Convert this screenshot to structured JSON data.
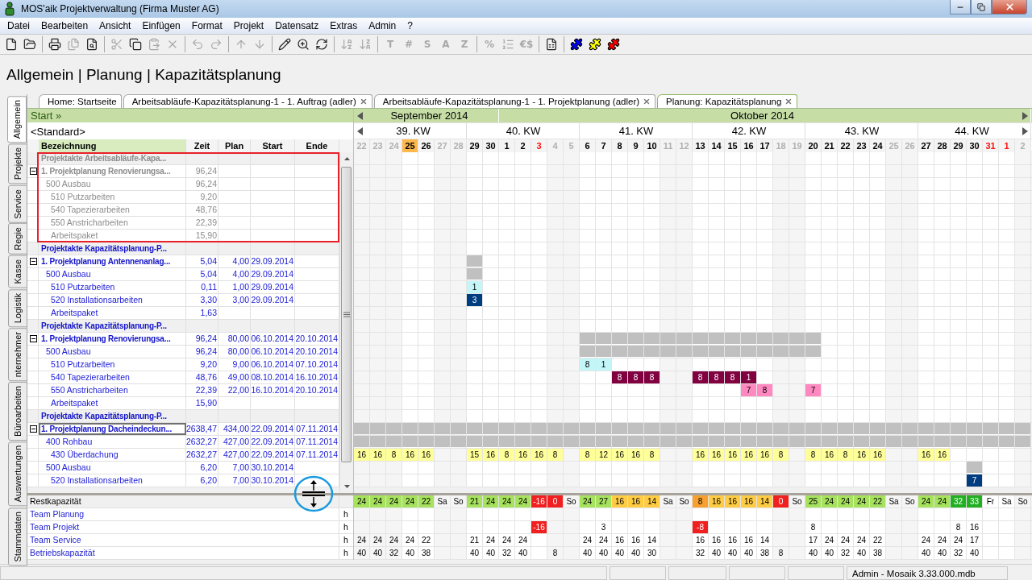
{
  "window": {
    "title": "MOS'aik Projektverwaltung (Firma Muster AG)"
  },
  "menu": [
    "Datei",
    "Bearbeiten",
    "Ansicht",
    "Einfügen",
    "Format",
    "Projekt",
    "Datensatz",
    "Extras",
    "Admin",
    "?"
  ],
  "toolbar": [
    {
      "kind": "new",
      "disabled": false
    },
    {
      "kind": "open",
      "disabled": false
    },
    {
      "kind": "separator"
    },
    {
      "kind": "print",
      "disabled": false
    },
    {
      "kind": "printall",
      "disabled": true
    },
    {
      "kind": "preview",
      "disabled": false
    },
    {
      "kind": "separator"
    },
    {
      "kind": "cut",
      "disabled": true
    },
    {
      "kind": "copy",
      "disabled": false
    },
    {
      "kind": "paste",
      "disabled": true
    },
    {
      "kind": "delete",
      "disabled": true
    },
    {
      "kind": "separator"
    },
    {
      "kind": "undo",
      "disabled": true
    },
    {
      "kind": "redo",
      "disabled": true
    },
    {
      "kind": "separator"
    },
    {
      "kind": "up",
      "disabled": true
    },
    {
      "kind": "down",
      "disabled": true
    },
    {
      "kind": "separator"
    },
    {
      "kind": "edit",
      "disabled": false
    },
    {
      "kind": "zoom",
      "disabled": false
    },
    {
      "kind": "refresh",
      "disabled": false
    },
    {
      "kind": "separator"
    },
    {
      "kind": "sortaz",
      "disabled": true
    },
    {
      "kind": "sortza",
      "disabled": true
    },
    {
      "kind": "separator"
    },
    {
      "kind": "glyph",
      "text": "T",
      "disabled": true
    },
    {
      "kind": "glyph",
      "text": "#",
      "disabled": true
    },
    {
      "kind": "glyph",
      "text": "S",
      "disabled": true
    },
    {
      "kind": "glyph",
      "text": "A",
      "disabled": true
    },
    {
      "kind": "glyph",
      "text": "Z",
      "disabled": true
    },
    {
      "kind": "separator"
    },
    {
      "kind": "glyph",
      "text": "%",
      "disabled": true
    },
    {
      "kind": "numbering",
      "disabled": true
    },
    {
      "kind": "glyph",
      "text": "€$",
      "disabled": true
    },
    {
      "kind": "separator"
    },
    {
      "kind": "export",
      "disabled": false
    },
    {
      "kind": "separator"
    },
    {
      "kind": "puzzle",
      "color": "#0000ff"
    },
    {
      "kind": "puzzle",
      "color": "#ffff00"
    },
    {
      "kind": "puzzle",
      "color": "#ff0000"
    }
  ],
  "breadcrumb": "Allgemein | Planung | Kapazitätsplanung",
  "vertical_tabs": [
    {
      "label": "Allgemein",
      "selected": true
    },
    {
      "label": "Projekte",
      "selected": false
    },
    {
      "label": "Service",
      "selected": false
    },
    {
      "label": "Regie",
      "selected": false
    },
    {
      "label": "Kasse",
      "selected": false
    },
    {
      "label": "Logistik",
      "selected": false
    },
    {
      "label": "nternehmer",
      "selected": false
    },
    {
      "label": "Büroarbeiten",
      "selected": false
    },
    {
      "label": "Auswertungen",
      "selected": false
    },
    {
      "label": "Stammdaten",
      "selected": false
    }
  ],
  "doc_tabs": [
    {
      "label": "Home: Startseite",
      "closable": false,
      "selected": false
    },
    {
      "label": "Arbeitsabläufe-Kapazitätsplanung-1 - 1. Auftrag (adler)",
      "closable": true,
      "selected": false
    },
    {
      "label": "Arbeitsabläufe-Kapazitätsplanung-1 - 1. Projektplanung (adler)",
      "closable": true,
      "selected": false
    },
    {
      "label": "Planung: Kapazitätsplanung",
      "closable": true,
      "selected": true
    }
  ],
  "start_link": "Start »",
  "view": "<Standard>",
  "columns": [
    "Bezeichnung",
    "Zeit",
    "Plan",
    "Start",
    "Ende"
  ],
  "months": [
    {
      "label": "September 2014",
      "days": [
        {
          "label": "22",
          "kind": "past"
        },
        {
          "label": "23",
          "kind": "past"
        },
        {
          "label": "24",
          "kind": "past"
        },
        {
          "label": "25",
          "kind": "today"
        },
        {
          "label": "26",
          "kind": "work"
        },
        {
          "label": "27",
          "kind": "weekend"
        },
        {
          "label": "28",
          "kind": "weekend"
        },
        {
          "label": "29",
          "kind": "work"
        },
        {
          "label": "30",
          "kind": "work"
        }
      ]
    },
    {
      "label": "Oktober 2014",
      "days": [
        {
          "label": "1",
          "kind": "work"
        },
        {
          "label": "2",
          "kind": "work"
        },
        {
          "label": "3",
          "kind": "holiday"
        },
        {
          "label": "4",
          "kind": "weekend"
        },
        {
          "label": "5",
          "kind": "weekend"
        },
        {
          "label": "6",
          "kind": "work"
        },
        {
          "label": "7",
          "kind": "work"
        },
        {
          "label": "8",
          "kind": "work"
        },
        {
          "label": "9",
          "kind": "work"
        },
        {
          "label": "10",
          "kind": "work"
        },
        {
          "label": "11",
          "kind": "weekend"
        },
        {
          "label": "12",
          "kind": "weekend"
        },
        {
          "label": "13",
          "kind": "work"
        },
        {
          "label": "14",
          "kind": "work"
        },
        {
          "label": "15",
          "kind": "work"
        },
        {
          "label": "16",
          "kind": "work"
        },
        {
          "label": "17",
          "kind": "work"
        },
        {
          "label": "18",
          "kind": "weekend"
        },
        {
          "label": "19",
          "kind": "weekend"
        },
        {
          "label": "20",
          "kind": "work"
        },
        {
          "label": "21",
          "kind": "work"
        },
        {
          "label": "22",
          "kind": "work"
        },
        {
          "label": "23",
          "kind": "work"
        },
        {
          "label": "24",
          "kind": "work"
        },
        {
          "label": "25",
          "kind": "weekend"
        },
        {
          "label": "26",
          "kind": "weekend"
        },
        {
          "label": "27",
          "kind": "work"
        },
        {
          "label": "28",
          "kind": "work"
        },
        {
          "label": "29",
          "kind": "work"
        },
        {
          "label": "30",
          "kind": "work"
        },
        {
          "label": "31",
          "kind": "holiday"
        },
        {
          "label": "1",
          "kind": "holiday"
        },
        {
          "label": "2",
          "kind": "weekend"
        }
      ]
    }
  ],
  "weeks": [
    "39. KW",
    "40. KW",
    "41. KW",
    "42. KW",
    "43. KW",
    "44. KW"
  ],
  "projects": [
    {
      "title": "Projektakte Arbeitsabläufe-Kapa...",
      "muted": true,
      "highlighted": true,
      "plans": [
        {
          "label": "1. Projektplanung Renovierungsa...",
          "zeit": "96,24",
          "expanded": true,
          "focused": false,
          "children": [
            {
              "label": "500 Ausbau",
              "zeit": "96,24",
              "children": [
                {
                  "label": "510 Putzarbeiten",
                  "zeit": "9,20"
                },
                {
                  "label": "540 Tapezierarbeiten",
                  "zeit": "48,76"
                },
                {
                  "label": "550 Anstricharbeiten",
                  "zeit": "22,39"
                },
                {
                  "label": "Arbeitspaket",
                  "zeit": "15,90"
                }
              ]
            }
          ]
        }
      ]
    },
    {
      "title": "Projektakte Kapazitätsplanung-P...",
      "muted": false,
      "highlighted": false,
      "plans": [
        {
          "label": "1. Projektplanung Antennenanlag...",
          "zeit": "5,04",
          "plan": "4,00",
          "start": "29.09.2014",
          "expanded": true,
          "focused": false,
          "cells": [
            null,
            null,
            null,
            null,
            null,
            null,
            null,
            {
              "color": "#c0c0c0"
            }
          ],
          "children": [
            {
              "label": "500 Ausbau",
              "zeit": "5,04",
              "plan": "4,00",
              "start": "29.09.2014",
              "cells": [
                null,
                null,
                null,
                null,
                null,
                null,
                null,
                {
                  "color": "#c0c0c0"
                }
              ],
              "children": [
                {
                  "label": "510 Putzarbeiten",
                  "zeit": "0,11",
                  "plan": "1,00",
                  "start": "29.09.2014",
                  "cells": [
                    null,
                    null,
                    null,
                    null,
                    null,
                    null,
                    null,
                    {
                      "color": "#c4f6f8",
                      "text": "1"
                    }
                  ]
                },
                {
                  "label": "520 Installationsarbeiten",
                  "zeit": "3,30",
                  "plan": "3,00",
                  "start": "29.09.2014",
                  "cells": [
                    null,
                    null,
                    null,
                    null,
                    null,
                    null,
                    null,
                    {
                      "color": "#003c80",
                      "text": "3"
                    }
                  ]
                },
                {
                  "label": "Arbeitspaket",
                  "zeit": "1,63"
                }
              ]
            }
          ]
        }
      ]
    },
    {
      "title": "Projektakte Kapazitätsplanung-P...",
      "muted": false,
      "highlighted": false,
      "plans": [
        {
          "label": "1. Projektplanung Renovierungsa...",
          "zeit": "96,24",
          "plan": "80,00",
          "start": "06.10.2014",
          "ende": "20.10.2014",
          "expanded": true,
          "focused": false,
          "cells": [
            null,
            null,
            null,
            null,
            null,
            null,
            null,
            null,
            null,
            null,
            null,
            null,
            null,
            null,
            {
              "color": "#c0c0c0"
            },
            {
              "color": "#c0c0c0"
            },
            {
              "color": "#c0c0c0"
            },
            {
              "color": "#c0c0c0"
            },
            {
              "color": "#c0c0c0"
            },
            {
              "color": "#c0c0c0"
            },
            {
              "color": "#c0c0c0"
            },
            {
              "color": "#c0c0c0"
            },
            {
              "color": "#c0c0c0"
            },
            {
              "color": "#c0c0c0"
            },
            {
              "color": "#c0c0c0"
            },
            {
              "color": "#c0c0c0"
            },
            {
              "color": "#c0c0c0"
            },
            {
              "color": "#c0c0c0"
            },
            {
              "color": "#c0c0c0"
            }
          ],
          "children": [
            {
              "label": "500 Ausbau",
              "zeit": "96,24",
              "plan": "80,00",
              "start": "06.10.2014",
              "ende": "20.10.2014",
              "cells": [
                null,
                null,
                null,
                null,
                null,
                null,
                null,
                null,
                null,
                null,
                null,
                null,
                null,
                null,
                {
                  "color": "#c0c0c0"
                },
                {
                  "color": "#c0c0c0"
                },
                {
                  "color": "#c0c0c0"
                },
                {
                  "color": "#c0c0c0"
                },
                {
                  "color": "#c0c0c0"
                },
                {
                  "color": "#c0c0c0"
                },
                {
                  "color": "#c0c0c0"
                },
                {
                  "color": "#c0c0c0"
                },
                {
                  "color": "#c0c0c0"
                },
                {
                  "color": "#c0c0c0"
                },
                {
                  "color": "#c0c0c0"
                },
                {
                  "color": "#c0c0c0"
                },
                {
                  "color": "#c0c0c0"
                },
                {
                  "color": "#c0c0c0"
                },
                {
                  "color": "#c0c0c0"
                }
              ],
              "children": [
                {
                  "label": "510 Putzarbeiten",
                  "zeit": "9,20",
                  "plan": "9,00",
                  "start": "06.10.2014",
                  "ende": "07.10.2014",
                  "cells": [
                    null,
                    null,
                    null,
                    null,
                    null,
                    null,
                    null,
                    null,
                    null,
                    null,
                    null,
                    null,
                    null,
                    null,
                    {
                      "color": "#c4f6f8",
                      "text": "8"
                    },
                    {
                      "color": "#c4f6f8",
                      "text": "1"
                    }
                  ]
                },
                {
                  "label": "540 Tapezierarbeiten",
                  "zeit": "48,76",
                  "plan": "49,00",
                  "start": "08.10.2014",
                  "ende": "16.10.2014",
                  "cells": [
                    null,
                    null,
                    null,
                    null,
                    null,
                    null,
                    null,
                    null,
                    null,
                    null,
                    null,
                    null,
                    null,
                    null,
                    null,
                    null,
                    {
                      "color": "#800040",
                      "text": "8"
                    },
                    {
                      "color": "#800040",
                      "text": "8"
                    },
                    {
                      "color": "#800040",
                      "text": "8"
                    },
                    null,
                    null,
                    {
                      "color": "#800040",
                      "text": "8"
                    },
                    {
                      "color": "#800040",
                      "text": "8"
                    },
                    {
                      "color": "#800040",
                      "text": "8"
                    },
                    {
                      "color": "#800040",
                      "text": "1"
                    }
                  ]
                },
                {
                  "label": "550 Anstricharbeiten",
                  "zeit": "22,39",
                  "plan": "22,00",
                  "start": "16.10.2014",
                  "ende": "20.10.2014",
                  "cells": [
                    null,
                    null,
                    null,
                    null,
                    null,
                    null,
                    null,
                    null,
                    null,
                    null,
                    null,
                    null,
                    null,
                    null,
                    null,
                    null,
                    null,
                    null,
                    null,
                    null,
                    null,
                    null,
                    null,
                    null,
                    {
                      "color": "#ff88c0",
                      "text": "7"
                    },
                    {
                      "color": "#ff88c0",
                      "text": "8"
                    },
                    null,
                    null,
                    {
                      "color": "#ff88c0",
                      "text": "7"
                    }
                  ]
                },
                {
                  "label": "Arbeitspaket",
                  "zeit": "15,90"
                }
              ]
            }
          ]
        }
      ]
    },
    {
      "title": "Projektakte Kapazitätsplanung-P...",
      "muted": false,
      "highlighted": false,
      "plans": [
        {
          "label": "1. Projektplanung Dacheindeckun...",
          "zeit": "2638,47",
          "plan": "434,00",
          "start": "22.09.2014",
          "ende": "07.11.2014",
          "expanded": true,
          "focused": true,
          "cells": [
            {
              "color": "#c0c0c0"
            },
            {
              "color": "#c0c0c0"
            },
            {
              "color": "#c0c0c0"
            },
            {
              "color": "#c0c0c0"
            },
            {
              "color": "#c0c0c0"
            },
            {
              "color": "#c0c0c0"
            },
            {
              "color": "#c0c0c0"
            },
            {
              "color": "#c0c0c0"
            },
            {
              "color": "#c0c0c0"
            },
            {
              "color": "#c0c0c0"
            },
            {
              "color": "#c0c0c0"
            },
            {
              "color": "#c0c0c0"
            },
            {
              "color": "#c0c0c0"
            },
            {
              "color": "#c0c0c0"
            },
            {
              "color": "#c0c0c0"
            },
            {
              "color": "#c0c0c0"
            },
            {
              "color": "#c0c0c0"
            },
            {
              "color": "#c0c0c0"
            },
            {
              "color": "#c0c0c0"
            },
            {
              "color": "#c0c0c0"
            },
            {
              "color": "#c0c0c0"
            },
            {
              "color": "#c0c0c0"
            },
            {
              "color": "#c0c0c0"
            },
            {
              "color": "#c0c0c0"
            },
            {
              "color": "#c0c0c0"
            },
            {
              "color": "#c0c0c0"
            },
            {
              "color": "#c0c0c0"
            },
            {
              "color": "#c0c0c0"
            },
            {
              "color": "#c0c0c0"
            },
            {
              "color": "#c0c0c0"
            },
            {
              "color": "#c0c0c0"
            },
            {
              "color": "#c0c0c0"
            },
            {
              "color": "#c0c0c0"
            },
            {
              "color": "#c0c0c0"
            },
            {
              "color": "#c0c0c0"
            },
            {
              "color": "#c0c0c0"
            },
            {
              "color": "#c0c0c0"
            },
            {
              "color": "#c0c0c0"
            },
            {
              "color": "#c0c0c0"
            },
            {
              "color": "#c0c0c0"
            },
            {
              "color": "#c0c0c0"
            },
            {
              "color": "#c0c0c0"
            }
          ],
          "children": [
            {
              "label": "400 Rohbau",
              "zeit": "2632,27",
              "plan": "427,00",
              "start": "22.09.2014",
              "ende": "07.11.2014",
              "cells": [
                {
                  "color": "#c0c0c0"
                },
                {
                  "color": "#c0c0c0"
                },
                {
                  "color": "#c0c0c0"
                },
                {
                  "color": "#c0c0c0"
                },
                {
                  "color": "#c0c0c0"
                },
                {
                  "color": "#c0c0c0"
                },
                {
                  "color": "#c0c0c0"
                },
                {
                  "color": "#c0c0c0"
                },
                {
                  "color": "#c0c0c0"
                },
                {
                  "color": "#c0c0c0"
                },
                {
                  "color": "#c0c0c0"
                },
                {
                  "color": "#c0c0c0"
                },
                {
                  "color": "#c0c0c0"
                },
                {
                  "color": "#c0c0c0"
                },
                {
                  "color": "#c0c0c0"
                },
                {
                  "color": "#c0c0c0"
                },
                {
                  "color": "#c0c0c0"
                },
                {
                  "color": "#c0c0c0"
                },
                {
                  "color": "#c0c0c0"
                },
                {
                  "color": "#c0c0c0"
                },
                {
                  "color": "#c0c0c0"
                },
                {
                  "color": "#c0c0c0"
                },
                {
                  "color": "#c0c0c0"
                },
                {
                  "color": "#c0c0c0"
                },
                {
                  "color": "#c0c0c0"
                },
                {
                  "color": "#c0c0c0"
                },
                {
                  "color": "#c0c0c0"
                },
                {
                  "color": "#c0c0c0"
                },
                {
                  "color": "#c0c0c0"
                },
                {
                  "color": "#c0c0c0"
                },
                {
                  "color": "#c0c0c0"
                },
                {
                  "color": "#c0c0c0"
                },
                {
                  "color": "#c0c0c0"
                },
                {
                  "color": "#c0c0c0"
                },
                {
                  "color": "#c0c0c0"
                },
                {
                  "color": "#c0c0c0"
                },
                {
                  "color": "#c0c0c0"
                },
                {
                  "color": "#c0c0c0"
                },
                {
                  "color": "#c0c0c0"
                },
                {
                  "color": "#c0c0c0"
                },
                {
                  "color": "#c0c0c0"
                },
                {
                  "color": "#c0c0c0"
                }
              ],
              "children": [
                {
                  "label": "430 Überdachung",
                  "zeit": "2632,27",
                  "plan": "427,00",
                  "start": "22.09.2014",
                  "ende": "07.11.2014",
                  "cells": [
                    {
                      "color": "#ffff99",
                      "text": "16"
                    },
                    {
                      "color": "#ffff99",
                      "text": "16"
                    },
                    {
                      "color": "#ffff99",
                      "text": "8"
                    },
                    {
                      "color": "#ffff99",
                      "text": "16"
                    },
                    {
                      "color": "#ffff99",
                      "text": "16"
                    },
                    null,
                    null,
                    {
                      "color": "#ffff99",
                      "text": "15"
                    },
                    {
                      "color": "#ffff99",
                      "text": "16"
                    },
                    {
                      "color": "#ffff99",
                      "text": "8"
                    },
                    {
                      "color": "#ffff99",
                      "text": "16"
                    },
                    {
                      "color": "#ffff99",
                      "text": "16"
                    },
                    {
                      "color": "#ffff99",
                      "text": "8"
                    },
                    null,
                    {
                      "color": "#ffff99",
                      "text": "8"
                    },
                    {
                      "color": "#ffff99",
                      "text": "12"
                    },
                    {
                      "color": "#ffff99",
                      "text": "16"
                    },
                    {
                      "color": "#ffff99",
                      "text": "16"
                    },
                    {
                      "color": "#ffff99",
                      "text": "8"
                    },
                    null,
                    null,
                    {
                      "color": "#ffff99",
                      "text": "16"
                    },
                    {
                      "color": "#ffff99",
                      "text": "16"
                    },
                    {
                      "color": "#ffff99",
                      "text": "16"
                    },
                    {
                      "color": "#ffff99",
                      "text": "16"
                    },
                    {
                      "color": "#ffff99",
                      "text": "16"
                    },
                    {
                      "color": "#ffff99",
                      "text": "8"
                    },
                    null,
                    {
                      "color": "#ffff99",
                      "text": "8"
                    },
                    {
                      "color": "#ffff99",
                      "text": "16"
                    },
                    {
                      "color": "#ffff99",
                      "text": "8"
                    },
                    {
                      "color": "#ffff99",
                      "text": "16"
                    },
                    {
                      "color": "#ffff99",
                      "text": "16"
                    },
                    null,
                    null,
                    {
                      "color": "#ffff99",
                      "text": "16"
                    },
                    {
                      "color": "#ffff99",
                      "text": "16"
                    }
                  ]
                }
              ]
            },
            {
              "label": "500 Ausbau",
              "zeit": "6,20",
              "plan": "7,00",
              "start": "30.10.2014",
              "cells": [
                null,
                null,
                null,
                null,
                null,
                null,
                null,
                null,
                null,
                null,
                null,
                null,
                null,
                null,
                null,
                null,
                null,
                null,
                null,
                null,
                null,
                null,
                null,
                null,
                null,
                null,
                null,
                null,
                null,
                null,
                null,
                null,
                null,
                null,
                null,
                null,
                null,
                null,
                {
                  "color": "#c0c0c0"
                }
              ],
              "children": [
                {
                  "label": "520 Installationsarbeiten",
                  "zeit": "6,20",
                  "plan": "7,00",
                  "start": "30.10.2014",
                  "cells": [
                    null,
                    null,
                    null,
                    null,
                    null,
                    null,
                    null,
                    null,
                    null,
                    null,
                    null,
                    null,
                    null,
                    null,
                    null,
                    null,
                    null,
                    null,
                    null,
                    null,
                    null,
                    null,
                    null,
                    null,
                    null,
                    null,
                    null,
                    null,
                    null,
                    null,
                    null,
                    null,
                    null,
                    null,
                    null,
                    null,
                    null,
                    null,
                    {
                      "color": "#003c80",
                      "text": "7"
                    }
                  ]
                }
              ]
            }
          ]
        }
      ]
    }
  ],
  "capacity": [
    {
      "label": "Restkapazität",
      "kind": "summary",
      "cells": [
        {
          "text": "24",
          "color": "#a6e25e"
        },
        {
          "text": "24",
          "color": "#a6e25e"
        },
        {
          "text": "24",
          "color": "#a6e25e"
        },
        {
          "text": "24",
          "color": "#a6e25e"
        },
        {
          "text": "22",
          "color": "#a6e25e"
        },
        {
          "text": "Sa"
        },
        {
          "text": "So"
        },
        {
          "text": "21",
          "color": "#a6e25e"
        },
        {
          "text": "24",
          "color": "#a6e25e"
        },
        {
          "text": "24",
          "color": "#a6e25e"
        },
        {
          "text": "24",
          "color": "#a6e25e"
        },
        {
          "text": "-16",
          "color": "#f02020"
        },
        {
          "text": "0",
          "color": "#f02020"
        },
        {
          "text": "So"
        },
        {
          "text": "24",
          "color": "#a6e25e"
        },
        {
          "text": "27",
          "color": "#a6e25e"
        },
        {
          "text": "16",
          "color": "#ffcc44"
        },
        {
          "text": "16",
          "color": "#ffcc44"
        },
        {
          "text": "14",
          "color": "#ffcc44"
        },
        {
          "text": "Sa"
        },
        {
          "text": "So"
        },
        {
          "text": "8",
          "color": "#f7a030"
        },
        {
          "text": "16",
          "color": "#ffcc44"
        },
        {
          "text": "16",
          "color": "#ffcc44"
        },
        {
          "text": "16",
          "color": "#ffcc44"
        },
        {
          "text": "14",
          "color": "#ffcc44"
        },
        {
          "text": "0",
          "color": "#f02020"
        },
        {
          "text": "So"
        },
        {
          "text": "25",
          "color": "#a6e25e"
        },
        {
          "text": "24",
          "color": "#a6e25e"
        },
        {
          "text": "24",
          "color": "#a6e25e"
        },
        {
          "text": "24",
          "color": "#a6e25e"
        },
        {
          "text": "22",
          "color": "#a6e25e"
        },
        {
          "text": "Sa"
        },
        {
          "text": "So"
        },
        {
          "text": "24",
          "color": "#a6e25e"
        },
        {
          "text": "24",
          "color": "#a6e25e"
        },
        {
          "text": "32",
          "color": "#22b022"
        },
        {
          "text": "33",
          "color": "#22b022"
        },
        {
          "text": "Fr"
        },
        {
          "text": "Sa"
        },
        {
          "text": "So"
        }
      ]
    },
    {
      "label": "Team Planung",
      "kind": "team",
      "unit": "h"
    },
    {
      "label": "Team Projekt",
      "kind": "team",
      "unit": "h",
      "cells": [
        null,
        null,
        null,
        null,
        null,
        null,
        null,
        null,
        null,
        null,
        null,
        {
          "text": "-16",
          "color": "#f02020"
        },
        null,
        null,
        null,
        {
          "text": "3"
        },
        null,
        null,
        null,
        null,
        null,
        {
          "text": "-8",
          "color": "#f02020"
        },
        null,
        null,
        null,
        null,
        null,
        null,
        {
          "text": "8"
        },
        null,
        null,
        null,
        null,
        null,
        null,
        null,
        null,
        {
          "text": "8"
        },
        {
          "text": "16"
        }
      ]
    },
    {
      "label": "Team Service",
      "kind": "team",
      "unit": "h",
      "cells": [
        "24",
        "24",
        "24",
        "24",
        "22",
        null,
        null,
        "21",
        "24",
        "24",
        "24",
        null,
        null,
        null,
        "24",
        "24",
        "16",
        "16",
        "14",
        null,
        null,
        "16",
        "16",
        "16",
        "16",
        "14",
        null,
        null,
        "17",
        "24",
        "24",
        "24",
        "22",
        null,
        null,
        "24",
        "24",
        "24",
        "17"
      ]
    },
    {
      "label": "Betriebskapazität",
      "kind": "team",
      "unit": "h",
      "cells": [
        "40",
        "40",
        "32",
        "40",
        "38",
        null,
        null,
        "40",
        "40",
        "32",
        "40",
        null,
        "8",
        null,
        "40",
        "40",
        "40",
        "40",
        "30",
        null,
        null,
        "32",
        "40",
        "40",
        "40",
        "38",
        "8",
        null,
        "40",
        "40",
        "32",
        "40",
        "38",
        null,
        null,
        "40",
        "40",
        "32",
        "40"
      ]
    }
  ],
  "status_bar": {
    "text": "Admin - Mosaik 3.33.000.mdb"
  }
}
